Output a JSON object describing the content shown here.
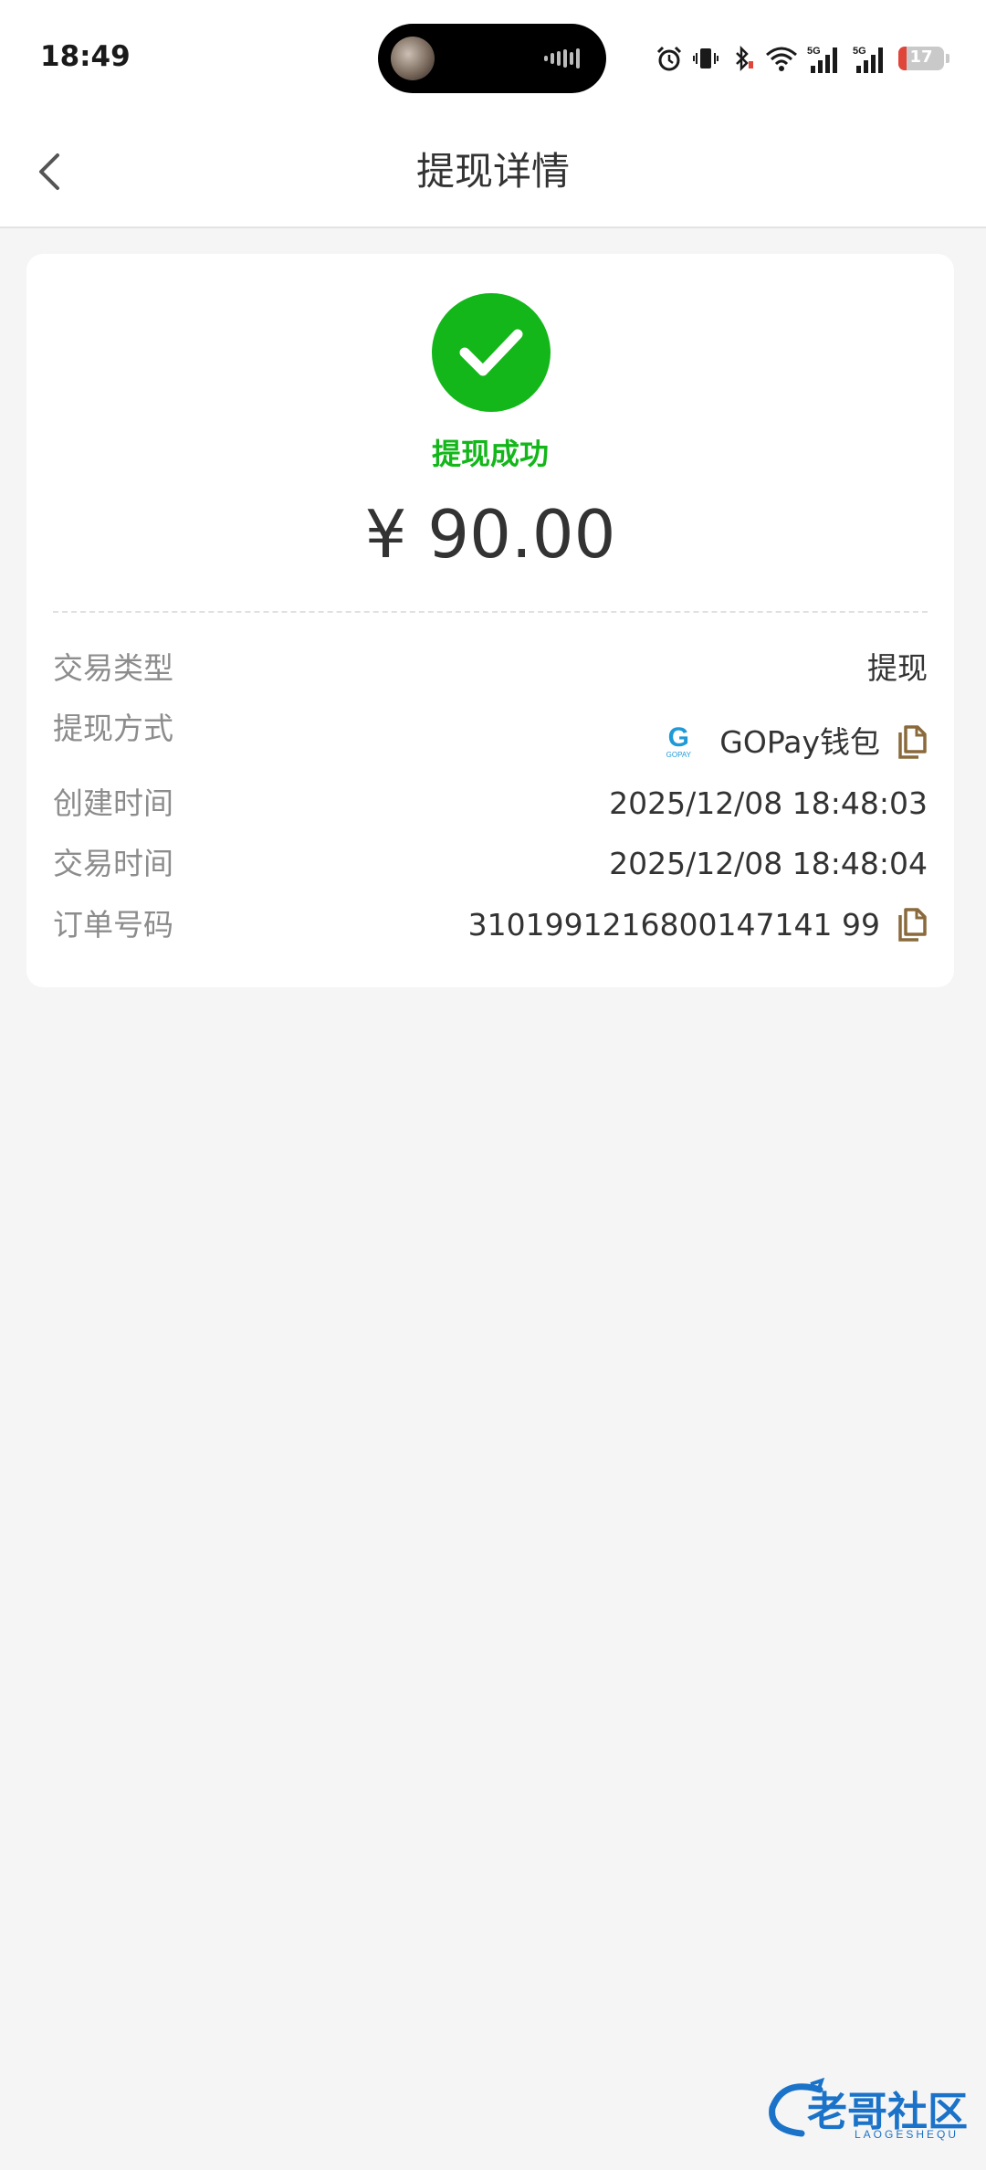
{
  "status_bar": {
    "time": "18:49",
    "battery_level": "17",
    "icons": [
      "alarm-icon",
      "vibrate-icon",
      "bluetooth-icon",
      "wifi-icon",
      "signal-5g-icon",
      "signal-5g-icon",
      "battery-icon"
    ]
  },
  "nav": {
    "title": "提现详情",
    "back_icon": "chevron-left-icon"
  },
  "card": {
    "status_icon": "check-circle-icon",
    "status_text": "提现成功",
    "amount": "¥ 90.00",
    "rows": [
      {
        "label": "交易类型",
        "value": "提现"
      },
      {
        "label": "提现方式",
        "value": "GOPay钱包",
        "logo_text": "G",
        "logo_sub": "GOPAY"
      },
      {
        "label": "创建时间",
        "value": "2025/12/08 18:48:03"
      },
      {
        "label": "交易时间",
        "value": "2025/12/08 18:48:04"
      },
      {
        "label": "订单号码",
        "value": "3101991216800147141 99"
      }
    ]
  },
  "watermark": {
    "text": "老哥社区",
    "sub": "LAOGESHEQU"
  },
  "colors": {
    "success_green": "#13b71a",
    "copy_icon_brown": "#8a6a3c",
    "background": "#f5f5f5"
  }
}
